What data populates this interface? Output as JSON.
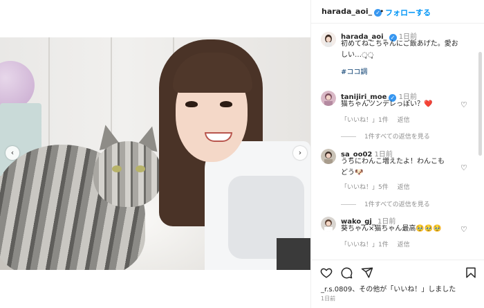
{
  "post": {
    "author": "harada_aoi_",
    "follow_dot": "•",
    "follow_label": "フォローする",
    "caption": "初めてねこちゃんにご飯あげた。愛おしい…◌̥◌̥",
    "caption_line1": "初めてねこちゃんにご飯あげた。愛お",
    "caption_line2": "しい…◌̥◌̥",
    "caption_time": "1日前",
    "hashtag": "#ココ調"
  },
  "carousel": {
    "prev_icon": "‹",
    "next_icon": "›"
  },
  "comments": [
    {
      "user": "tanijiri_moe",
      "verified": true,
      "time": "1日前",
      "text": "猫ちゃんツンデレっぽい？❤️",
      "likes_label": "「いいね！」1件",
      "reply_label": "返信",
      "view_replies": "1件すべての返信を見る"
    },
    {
      "user": "sa_oo02",
      "verified": false,
      "time": "1日前",
      "text_line1": "うちにわんこ増えたよ！わんこも",
      "text_line2": "どう🐶",
      "likes_label": "「いいね！」5件",
      "reply_label": "返信",
      "view_replies": "1件すべての返信を見る"
    },
    {
      "user": "wako_gj_",
      "verified": false,
      "time": "1日前",
      "text": "葵ちゃん×猫ちゃん最高🥹🥹🥹",
      "likes_label": "「いいね！」1件",
      "reply_label": "返信"
    }
  ],
  "footer": {
    "liked_by_user": "_r.s.0809",
    "liked_by_rest": "、その他が「いいね！」しました",
    "others_bold": "その他",
    "date": "1日前"
  },
  "icons": [
    "heart-icon",
    "comment-icon",
    "share-icon",
    "bookmark-icon",
    "verified-badge-icon"
  ],
  "colors": {
    "link_blue": "#0095f6",
    "verified_blue": "#3897f0",
    "hashtag": "#00376b",
    "secondary_text": "#8e8e8e"
  }
}
